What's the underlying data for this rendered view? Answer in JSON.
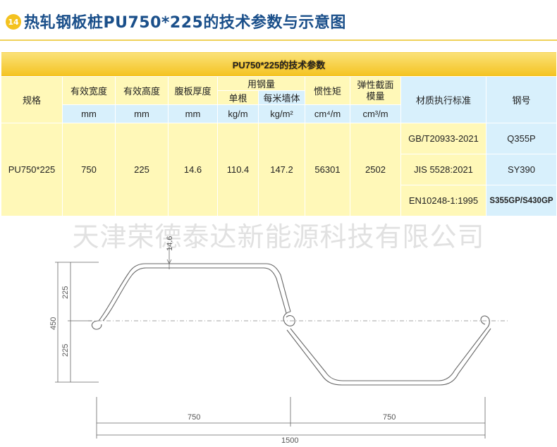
{
  "header": {
    "badge": "14",
    "title": "热轧钢板桩PU750*225的技术参数与示意图"
  },
  "table": {
    "banner": "PU750*225的技术参数",
    "col_spec": "规格",
    "col_width": "有效宽度",
    "col_height": "有效高度",
    "col_web": "腹板厚度",
    "col_steel": "用钢量",
    "col_single": "单根",
    "col_per_m2": "每米墙体",
    "col_inertia": "惯性矩",
    "col_modulus": "弹性截面模量",
    "col_material_std": "材质执行标准",
    "col_grade": "钢号",
    "units": [
      "mm",
      "mm",
      "mm",
      "kg/m",
      "kg/m²",
      "cm⁴/m",
      "cm³/m"
    ],
    "row": {
      "spec": "PU750*225",
      "width": "750",
      "height": "225",
      "web": "14.6",
      "single": "110.4",
      "per_m2": "147.2",
      "inertia": "56301",
      "modulus": "2502"
    },
    "standards": [
      {
        "standard": "GB/T20933-2021",
        "grade": "Q355P"
      },
      {
        "standard": "JIS 5528:2021",
        "grade": "SY390"
      },
      {
        "standard": "EN10248-1:1995",
        "grade": "S355GP/S430GP"
      }
    ]
  },
  "watermark": "天津荣德泰达新能源科技有限公司",
  "drawing": {
    "thickness": "14.6",
    "upper_height": "225",
    "total_height": "450",
    "lower_height": "225",
    "left_width": "750",
    "right_width": "750",
    "total_width": "1500"
  }
}
